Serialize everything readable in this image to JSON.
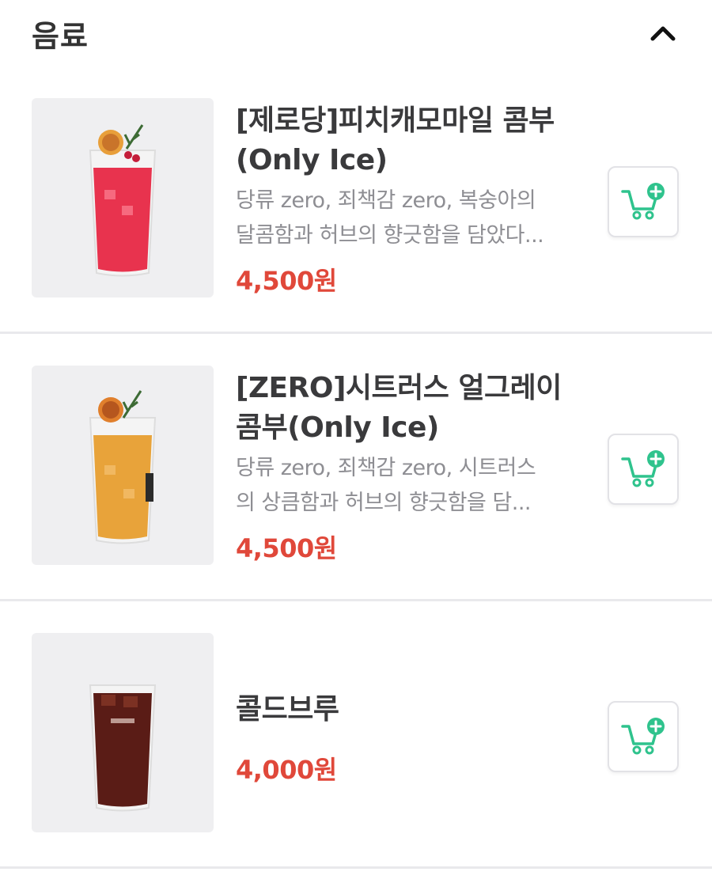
{
  "section": {
    "title": "음료",
    "collapse_icon": "chevron-up-icon"
  },
  "items": [
    {
      "name_line1": "[제로당]피치캐모마일 콤부",
      "name_line2": "(Only Ice)",
      "desc_line1": "당류 zero, 죄책감 zero, 복숭아의",
      "desc_line2": "달콤함과 허브의 향긋함을 담았다...",
      "price": "4,500원",
      "drink_color": "#e8334e",
      "cart_icon": "add-to-cart-icon"
    },
    {
      "name_line1": "[ZERO]시트러스 얼그레이",
      "name_line2": "콤부(Only Ice)",
      "desc_line1": "당류 zero, 죄책감 zero, 시트러스",
      "desc_line2": "의 상큼함과 허브의 향긋함을 담...",
      "price": "4,500원",
      "drink_color": "#e8a33a",
      "cart_icon": "add-to-cart-icon"
    },
    {
      "name_line1": "콜드브루",
      "price": "4,000원",
      "drink_color": "#5a1c16",
      "cart_icon": "add-to-cart-icon"
    }
  ],
  "colors": {
    "price": "#e0483a",
    "cart_accent": "#2fc38d"
  }
}
